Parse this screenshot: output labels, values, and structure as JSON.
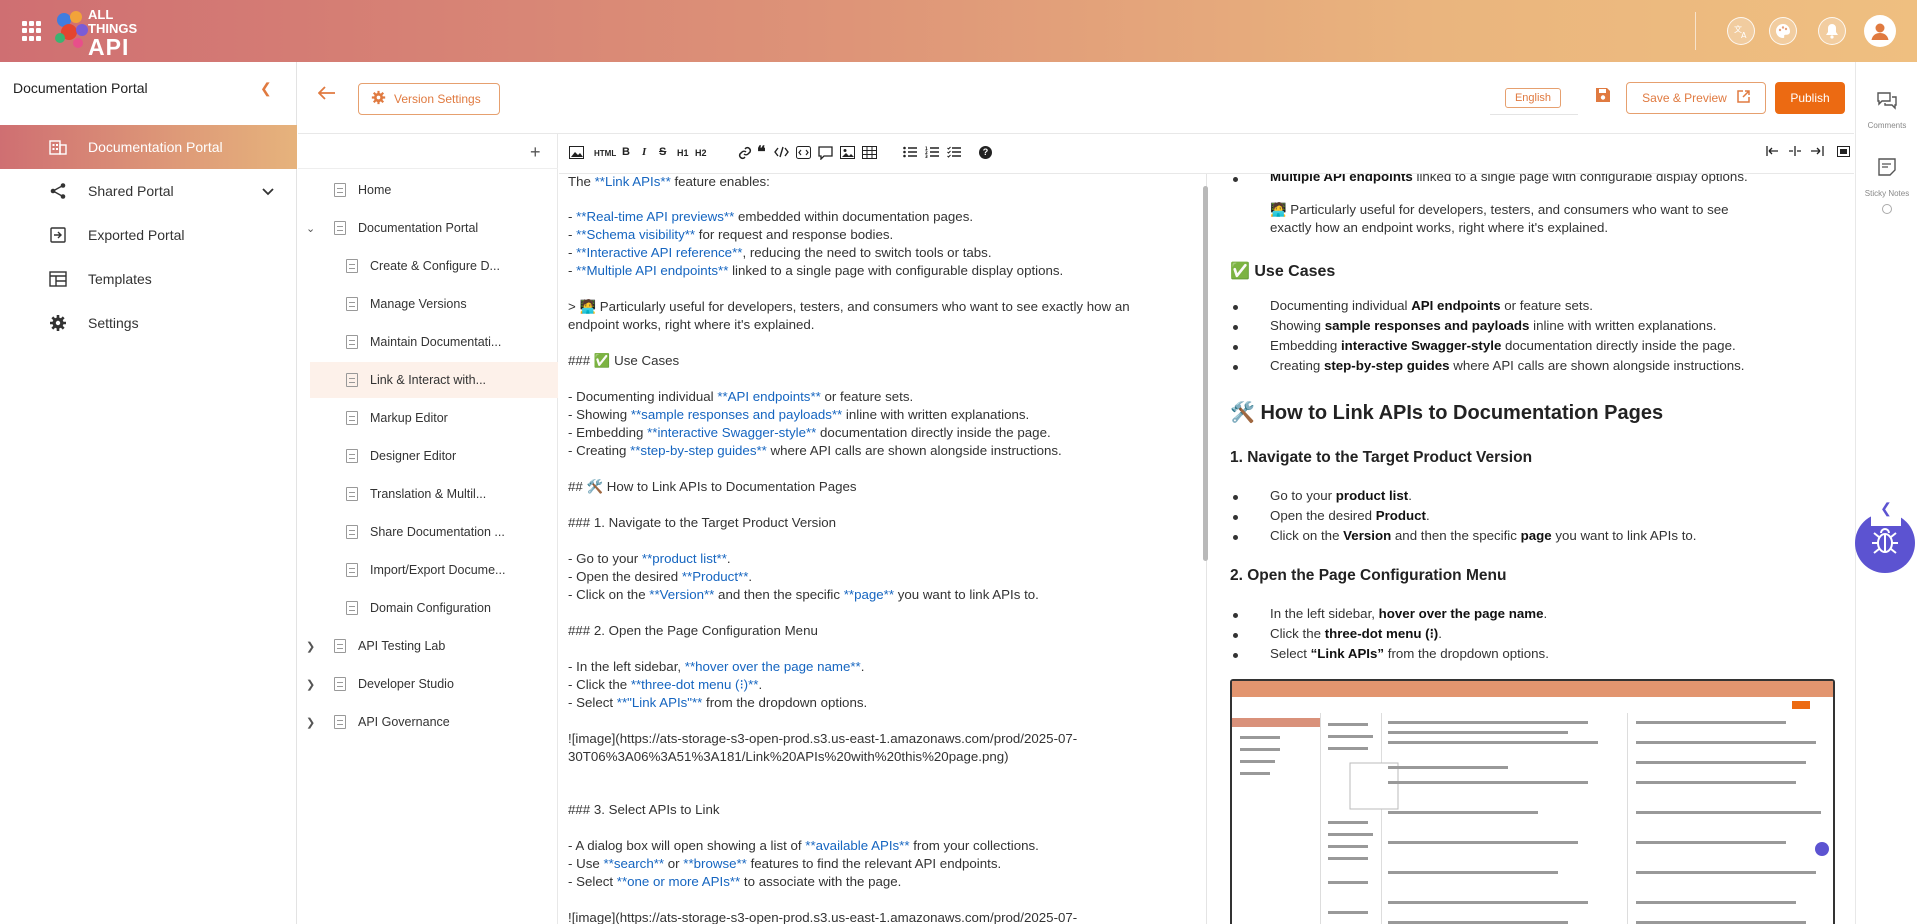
{
  "brand": {
    "line1": "ALL",
    "line2": "THINGS",
    "line3": "API"
  },
  "colors": {
    "accent": "#ec6a12",
    "link": "#1565c0",
    "fab": "#5c53d1"
  },
  "header_icons": [
    "translate-icon",
    "palette-icon",
    "bell-icon",
    "user-avatar-icon"
  ],
  "sidebar": {
    "title": "Documentation Portal",
    "items": [
      {
        "label": "Documentation Portal",
        "icon": "building-icon"
      },
      {
        "label": "Shared Portal",
        "icon": "share-icon"
      },
      {
        "label": "Exported Portal",
        "icon": "export-icon"
      },
      {
        "label": "Templates",
        "icon": "templates-icon"
      },
      {
        "label": "Settings",
        "icon": "gear-icon"
      }
    ]
  },
  "pagebar": {
    "version_settings": "Version Settings",
    "language": "English",
    "save_preview": "Save & Preview",
    "publish": "Publish"
  },
  "tree": {
    "items": [
      {
        "label": "Home"
      },
      {
        "label": "Documentation Portal"
      },
      {
        "label": "Create & Configure D..."
      },
      {
        "label": "Manage Versions"
      },
      {
        "label": "Maintain Documentati..."
      },
      {
        "label": "Link & Interact with..."
      },
      {
        "label": "Markup Editor"
      },
      {
        "label": "Designer Editor"
      },
      {
        "label": "Translation & Multil..."
      },
      {
        "label": "Share Documentation ..."
      },
      {
        "label": "Import/Export Docume..."
      },
      {
        "label": "Domain Configuration"
      },
      {
        "label": "API Testing Lab"
      },
      {
        "label": "Developer Studio"
      },
      {
        "label": "API Governance"
      }
    ]
  },
  "toolbar": {
    "html": "HTML",
    "bold": "B",
    "italic": "I",
    "strike": "S",
    "h1": "H1",
    "h2": "H2",
    "help": "?"
  },
  "editor": {
    "lines": {
      "l1a": "The ",
      "l1b": "**Link APIs**",
      "l1c": " feature enables:",
      "l2a": "- ",
      "l2b": "**Real-time API previews**",
      "l2c": " embedded within documentation pages.",
      "l3a": "- ",
      "l3b": "**Schema visibility**",
      "l3c": " for request and response bodies.",
      "l4a": "- ",
      "l4b": "**Interactive API reference**",
      "l4c": ", reducing the need to switch tools or tabs.",
      "l5a": "- ",
      "l5b": "**Multiple API endpoints**",
      "l5c": " linked to a single page with configurable display options.",
      "l6": "> 🧑‍💻 Particularly useful for developers, testers, and consumers who want to see exactly how an",
      "l6b": "endpoint works, right where it's explained.",
      "l7": "### ✅ Use Cases",
      "l8a": "- Documenting individual ",
      "l8b": "**API endpoints**",
      "l8c": " or feature sets.",
      "l9a": "- Showing ",
      "l9b": "**sample responses and payloads**",
      "l9c": " inline with written explanations.",
      "l10a": "- Embedding ",
      "l10b": "**interactive Swagger-style**",
      "l10c": " documentation directly inside the page.",
      "l11a": "- Creating ",
      "l11b": "**step-by-step guides**",
      "l11c": " where API calls are shown alongside instructions.",
      "l12": "## 🛠️ How to Link APIs to Documentation Pages",
      "l13": "### 1. Navigate to the Target Product Version",
      "l14a": "- Go to your ",
      "l14b": "**product list**",
      "l14c": ".",
      "l15a": "- Open the desired ",
      "l15b": "**Product**",
      "l15c": ".",
      "l16a": "- Click on the ",
      "l16b": "**Version**",
      "l16c": " and then the specific ",
      "l16d": "**page**",
      "l16e": " you want to link APIs to.",
      "l17": "### 2. Open the Page Configuration Menu",
      "l18a": "- In the left sidebar, ",
      "l18b": "**hover over the page name**",
      "l18c": ".",
      "l19a": "- Click the ",
      "l19b": "**three-dot menu (⁝)**",
      "l19c": ".",
      "l20a": "- Select ",
      "l20b": "**\"Link APIs\"**",
      "l20c": " from the dropdown options.",
      "l21": "![image](https://ats-storage-s3-open-prod.s3.us-east-1.amazonaws.com/prod/2025-07-",
      "l21b": "30T06%3A06%3A51%3A181/Link%20APIs%20with%20this%20page.png)",
      "l22": "### 3. Select APIs to Link",
      "l23a": "- A dialog box will open showing a list of ",
      "l23b": "**available APIs**",
      "l23c": " from your collections.",
      "l24a": "- Use ",
      "l24b": "**search**",
      "l24c": " or ",
      "l24d": "**browse**",
      "l24e": " features to find the relevant API endpoints.",
      "l25a": "- Select ",
      "l25b": "**one or more APIs**",
      "l25c": " to associate with the page.",
      "l26": "![image](https://ats-storage-s3-open-prod.s3.us-east-1.amazonaws.com/prod/2025-07-"
    }
  },
  "preview": {
    "p1a": "Multiple API endpoints",
    "p1b": " linked to a single page with configurable display options.",
    "p2": "🧑‍💻 Particularly useful for developers, testers, and consumers who want to see",
    "p2b": "exactly how an endpoint works, right where it's explained.",
    "h_use": "✅ Use Cases",
    "u1a": "Documenting individual ",
    "u1b": "API endpoints",
    "u1c": " or feature sets.",
    "u2a": "Showing ",
    "u2b": "sample responses and payloads",
    "u2c": " inline with written explanations.",
    "u3a": "Embedding ",
    "u3b": "interactive Swagger-style",
    "u3c": " documentation directly inside the page.",
    "u4a": "Creating ",
    "u4b": "step-by-step guides",
    "u4c": " where API calls are shown alongside instructions.",
    "h_how": "🛠️ How to Link APIs to Documentation Pages",
    "h_s1": "1. Navigate to the Target Product Version",
    "s1a": "Go to your ",
    "s1b": "product list",
    "s1c": ".",
    "s2a": "Open the desired ",
    "s2b": "Product",
    "s2c": ".",
    "s3a": "Click on the ",
    "s3b": "Version",
    "s3c": " and then the specific ",
    "s3d": "page",
    "s3e": " you want to link APIs to.",
    "h_s2": "2. Open the Page Configuration Menu",
    "t1a": "In the left sidebar, ",
    "t1b": "hover over the page name",
    "t1c": ".",
    "t2a": "Click the ",
    "t2b": "three-dot menu (⁝)",
    "t2c": ".",
    "t3a": "Select ",
    "t3b": "“Link APIs”",
    "t3c": " from the dropdown options."
  },
  "rail": {
    "comments": "Comments",
    "sticky": "Sticky Notes"
  }
}
